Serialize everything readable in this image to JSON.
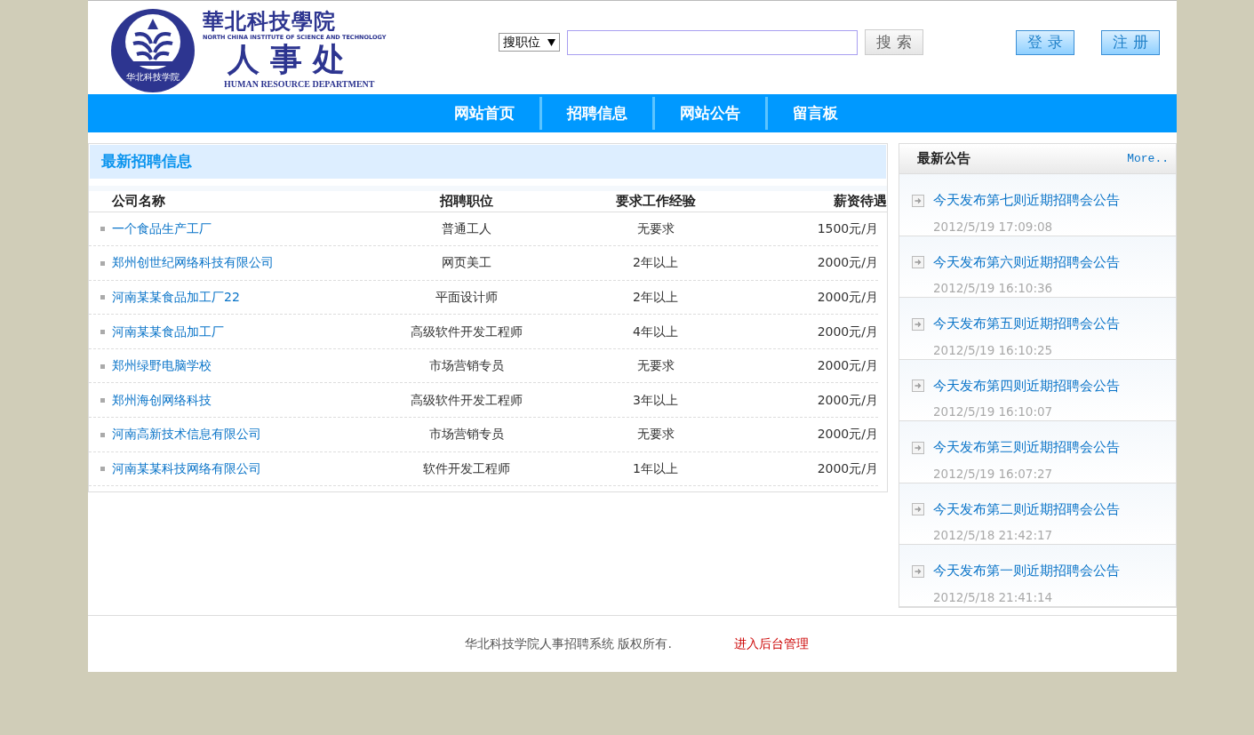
{
  "logo": {
    "school_cn": "華北科技學院",
    "school_en": "NORTH CHINA INSTITUTE OF SCIENCE AND TECHNOLOGY",
    "dept_cn": "人事处",
    "dept_en": "HUMAN RESOURCE DEPARTMENT",
    "seal_text": "华北科技学院"
  },
  "search": {
    "scope": "搜职位",
    "button": "搜 索"
  },
  "account_buttons": [
    "登 录",
    "注 册"
  ],
  "nav": [
    {
      "label": "网站首页"
    },
    {
      "label": "招聘信息"
    },
    {
      "label": "网站公告"
    },
    {
      "label": "留言板"
    }
  ],
  "jobs": {
    "title": "最新招聘信息",
    "columns": [
      "公司名称",
      "招聘职位",
      "要求工作经验",
      "薪资待遇"
    ],
    "rows": [
      {
        "company": "一个食品生产工厂",
        "position": "普通工人",
        "experience": "无要求",
        "salary": "1500元/月"
      },
      {
        "company": "郑州创世纪网络科技有限公司",
        "position": "网页美工",
        "experience": "2年以上",
        "salary": "2000元/月"
      },
      {
        "company": "河南某某食品加工厂22",
        "position": "平面设计师",
        "experience": "2年以上",
        "salary": "2000元/月"
      },
      {
        "company": "河南某某食品加工厂",
        "position": "高级软件开发工程师",
        "experience": "4年以上",
        "salary": "2000元/月"
      },
      {
        "company": "郑州绿野电脑学校",
        "position": "市场营销专员",
        "experience": "无要求",
        "salary": "2000元/月"
      },
      {
        "company": "郑州海创网络科技",
        "position": "高级软件开发工程师",
        "experience": "3年以上",
        "salary": "2000元/月"
      },
      {
        "company": "河南高新技术信息有限公司",
        "position": "市场营销专员",
        "experience": "无要求",
        "salary": "2000元/月"
      },
      {
        "company": "河南某某科技网络有限公司",
        "position": "软件开发工程师",
        "experience": "1年以上",
        "salary": "2000元/月"
      }
    ]
  },
  "notices": {
    "title": "最新公告",
    "more": "More..",
    "items": [
      {
        "title": "今天发布第七则近期招聘会公告",
        "time": "2012/5/19 17:09:08"
      },
      {
        "title": "今天发布第六则近期招聘会公告",
        "time": "2012/5/19 16:10:36"
      },
      {
        "title": "今天发布第五则近期招聘会公告",
        "time": "2012/5/19 16:10:25"
      },
      {
        "title": "今天发布第四则近期招聘会公告",
        "time": "2012/5/19 16:10:07"
      },
      {
        "title": "今天发布第三则近期招聘会公告",
        "time": "2012/5/19 16:07:27"
      },
      {
        "title": "今天发布第二则近期招聘会公告",
        "time": "2012/5/18 21:42:17"
      },
      {
        "title": "今天发布第一则近期招聘会公告",
        "time": "2012/5/18 21:41:14"
      }
    ]
  },
  "footer": {
    "copyright": "华北科技学院人事招聘系统 版权所有.",
    "admin_link": "进入后台管理"
  }
}
